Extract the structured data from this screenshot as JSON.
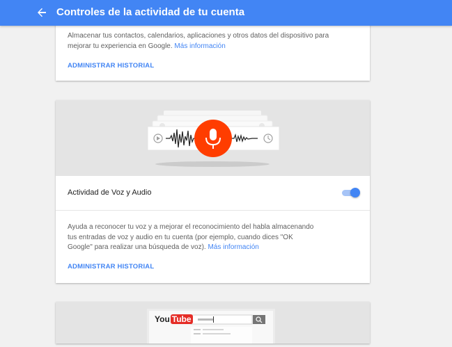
{
  "appbar": {
    "title": "Controles de la actividad de tu cuenta",
    "back_icon": "arrow-back-icon",
    "color": "#4285f4"
  },
  "device_card": {
    "description": "Almacenar tus contactos, calendarios, aplicaciones y otros datos del dispositivo para mejorar tu experiencia en Google.",
    "more_info": "Más información",
    "manage_label": "ADMINISTRAR HISTORIAL"
  },
  "voice_card": {
    "title": "Actividad de Voz y Audio",
    "toggle_on": true,
    "description": "Ayuda a reconocer tu voz y a mejorar el reconocimiento del habla almacenando tus entradas de voz y audio en tu cuenta (por ejemplo, cuando dices \"OK Google\" para realizar una búsqueda de voz).",
    "more_info": "Más información",
    "manage_label": "ADMINISTRAR HISTORIAL",
    "mic_color": "#ff3d00"
  },
  "youtube_card": {
    "logo_text": "You",
    "logo_tube": "Tube"
  },
  "accent": "#4285f4"
}
